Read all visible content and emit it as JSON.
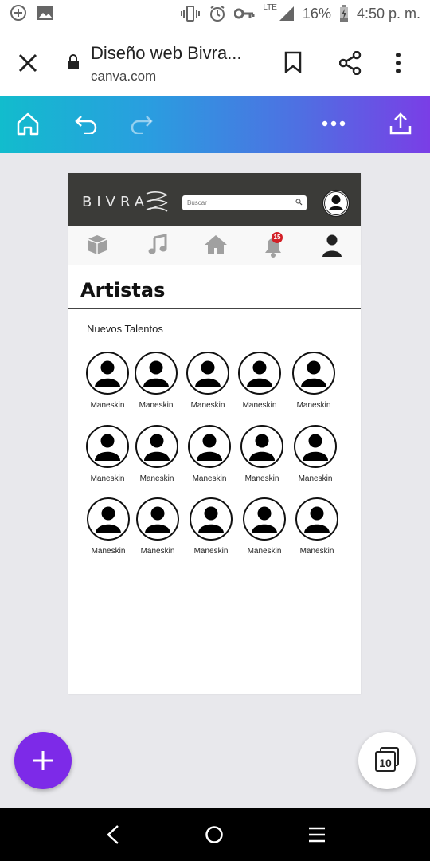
{
  "status_bar": {
    "signal_label": "LTE",
    "battery": "16%",
    "time": "4:50 p. m."
  },
  "browser": {
    "title": "Diseño web Bivra...",
    "url": "canva.com"
  },
  "design": {
    "logo": "BIVRA",
    "search_placeholder": "Buscar",
    "notification_badge": "15",
    "page_title": "Artistas",
    "section_title": "Nuevos Talentos",
    "artists": [
      "Maneskin",
      "Maneskin",
      "Maneskin",
      "Maneskin",
      "Maneskin",
      "Maneskin",
      "Maneskin",
      "Maneskin",
      "Maneskin",
      "Maneskin",
      "Maneskin",
      "Maneskin",
      "Maneskin",
      "Maneskin",
      "Maneskin"
    ]
  },
  "pages": {
    "count": "10"
  },
  "colors": {
    "accent_purple": "#7d2ae8",
    "header_dark": "#3b3b38",
    "badge_red": "#d32027"
  }
}
